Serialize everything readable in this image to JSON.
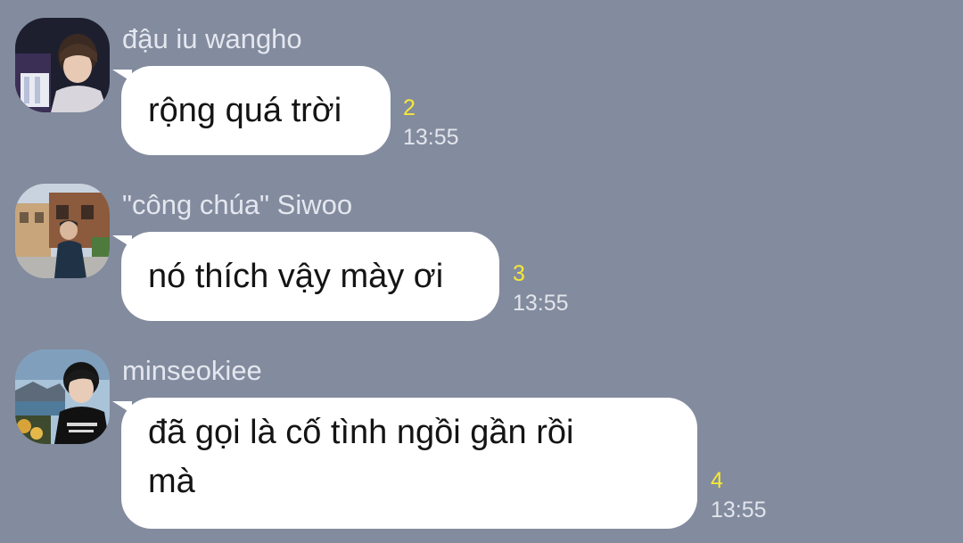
{
  "chat": {
    "messages": [
      {
        "sender": "đậu iu wangho",
        "text": "rộng quá trời",
        "unread": "2",
        "time": "13:55",
        "avatar": "profile-photo"
      },
      {
        "sender": "\"công chúa\" Siwoo",
        "text": "nó thích vậy mày ơi",
        "unread": "3",
        "time": "13:55",
        "avatar": "profile-photo"
      },
      {
        "sender": "minseokiee",
        "text": "đã gọi là cố tình ngồi gần rồi mà",
        "unread": "4",
        "time": "13:55",
        "avatar": "profile-photo"
      }
    ]
  },
  "colors": {
    "background": "#838b9e",
    "bubble": "#ffffff",
    "unread": "#f6e936",
    "meta_text": "#e2e5ec"
  }
}
